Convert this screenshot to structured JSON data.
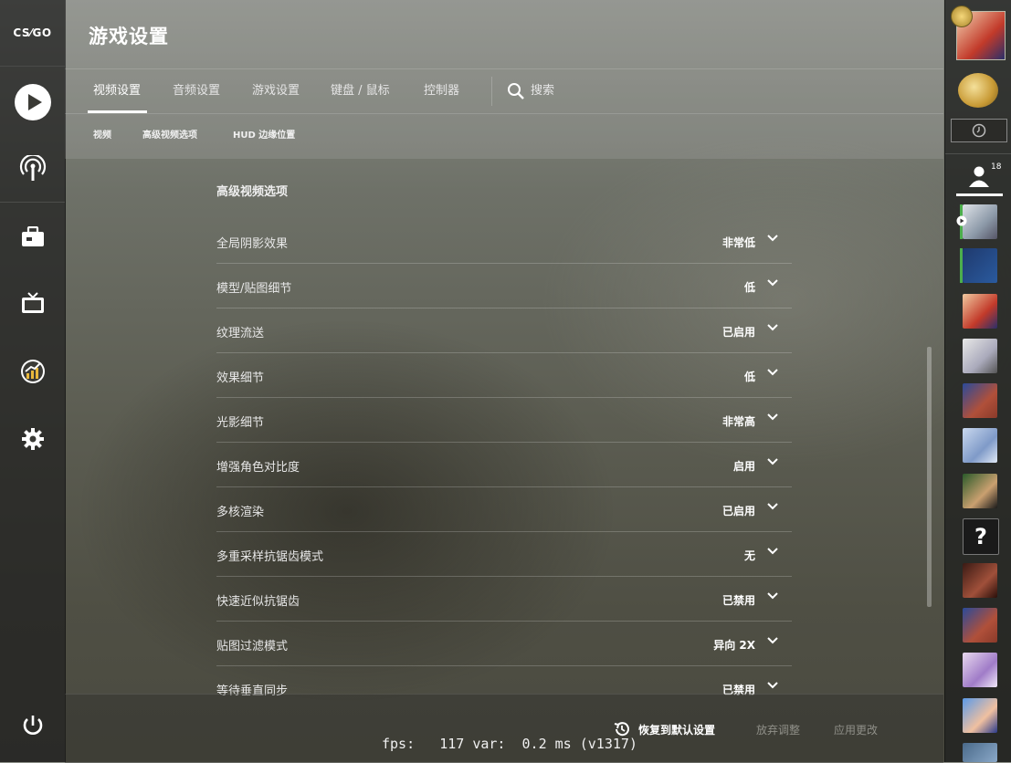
{
  "app": {
    "logo_text": "CS⁄GO",
    "page_title": "游戏设置"
  },
  "tabs": [
    {
      "label": "视频设置",
      "active": true
    },
    {
      "label": "音频设置"
    },
    {
      "label": "游戏设置"
    },
    {
      "label": "键盘 / 鼠标"
    },
    {
      "label": "控制器"
    }
  ],
  "search": {
    "label": "搜索"
  },
  "subtabs": [
    "视频",
    "高级视频选项",
    "HUD 边缘位置"
  ],
  "section": {
    "title": "高级视频选项"
  },
  "settings": [
    {
      "label": "全局阴影效果",
      "value": "非常低"
    },
    {
      "label": "模型/贴图细节",
      "value": "低"
    },
    {
      "label": "纹理流送",
      "value": "已启用"
    },
    {
      "label": "效果细节",
      "value": "低"
    },
    {
      "label": "光影细节",
      "value": "非常高"
    },
    {
      "label": "增强角色对比度",
      "value": "启用"
    },
    {
      "label": "多核渲染",
      "value": "已启用"
    },
    {
      "label": "多重采样抗锯齿模式",
      "value": "无"
    },
    {
      "label": "快速近似抗锯齿",
      "value": "已禁用"
    },
    {
      "label": "贴图过滤模式",
      "value": "异向 2X"
    },
    {
      "label": "等待垂直同步",
      "value": "已禁用"
    }
  ],
  "footer": {
    "restore": "恢复到默认设置",
    "discard": "放弃调整",
    "apply": "应用更改"
  },
  "fps_overlay": "fps:   117 var:  0.2 ms (v1317)",
  "friends": {
    "count": "18",
    "unknown_avatar": "?"
  },
  "colors": {
    "online_green": "#4cae4c",
    "text": "#ffffff",
    "disabled": "#8f8f88"
  }
}
